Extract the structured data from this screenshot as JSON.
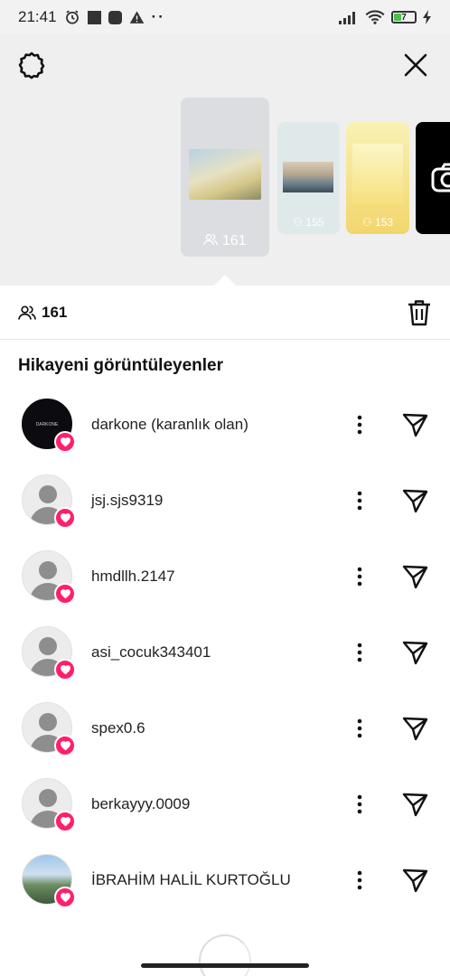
{
  "status_bar": {
    "time": "21:41",
    "battery": "7"
  },
  "story_tray": {
    "main_count": "161",
    "story2_count": "155",
    "story3_count": "153"
  },
  "viewer_bar": {
    "total": "161"
  },
  "section_title": "Hikayeni görüntüleyenler",
  "viewers": [
    {
      "username": "darkone (karanlık olan)",
      "avatar": "dark-logo",
      "tiny_text": "DARKONE"
    },
    {
      "username": "jsj.sjs9319",
      "avatar": "default"
    },
    {
      "username": "hmdllh.2147",
      "avatar": "default"
    },
    {
      "username": "asi_cocuk343401",
      "avatar": "default"
    },
    {
      "username": "spex0.6",
      "avatar": "default"
    },
    {
      "username": "berkayyy.0009",
      "avatar": "default"
    },
    {
      "username": "İBRAHİM HALİL KURTOĞLU",
      "avatar": "photo"
    }
  ],
  "colors": {
    "like_badge": "#ff1f6b",
    "tray_bg": "#efefef"
  },
  "icons": {
    "settings": "gear-icon",
    "close": "close-icon",
    "viewers": "people-icon",
    "delete": "trash-icon",
    "more": "more-vertical-icon",
    "send": "send-icon",
    "like": "heart-icon"
  }
}
